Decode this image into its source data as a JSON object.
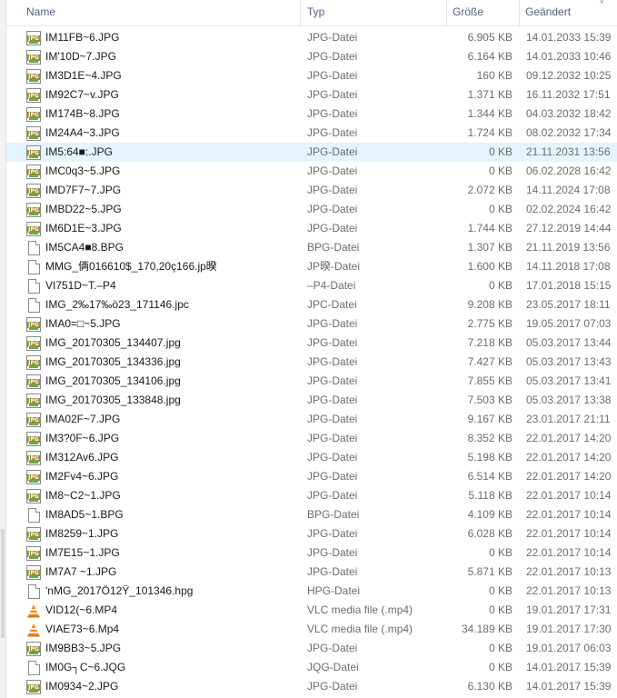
{
  "columns": {
    "name": "Name",
    "type": "Typ",
    "size": "Größe",
    "date": "Geändert"
  },
  "files": [
    {
      "name": "IM11FB~6.JPG",
      "type": "JPG-Datei",
      "size": "6.905 KB",
      "date": "14.01.2033 15:39",
      "icon": "jpg-file-icon"
    },
    {
      "name": "IM'10D~7.JPG",
      "type": "JPG-Datei",
      "size": "6.164 KB",
      "date": "14.01.2033 10:46",
      "icon": "jpg-file-icon"
    },
    {
      "name": "IM3D1E~4.JPG",
      "type": "JPG-Datei",
      "size": "160 KB",
      "date": "09.12.2032 10:25",
      "icon": "jpg-file-icon"
    },
    {
      "name": "IM92C7~v.JPG",
      "type": "JPG-Datei",
      "size": "1.371 KB",
      "date": "16.11.2032 17:51",
      "icon": "jpg-file-icon"
    },
    {
      "name": "IM174B~8.JPG",
      "type": "JPG-Datei",
      "size": "1.344 KB",
      "date": "04.03.2032 18:42",
      "icon": "jpg-file-icon"
    },
    {
      "name": "IM24A4~3.JPG",
      "type": "JPG-Datei",
      "size": "1.724 KB",
      "date": "08.02.2032 17:34",
      "icon": "jpg-file-icon"
    },
    {
      "name": "IM5:64■:.JPG",
      "type": "JPG-Datei",
      "size": "0 KB",
      "date": "21.11.2031 13:56",
      "icon": "jpg-file-icon",
      "selected": true
    },
    {
      "name": "IMC0q3~5.JPG",
      "type": "JPG-Datei",
      "size": "0 KB",
      "date": "06.02.2028 16:42",
      "icon": "jpg-file-icon"
    },
    {
      "name": "IMD7F7~7.JPG",
      "type": "JPG-Datei",
      "size": "2.072 KB",
      "date": "14.11.2024 17:08",
      "icon": "jpg-file-icon"
    },
    {
      "name": "IMBD22~5.JPG",
      "type": "JPG-Datei",
      "size": "0 KB",
      "date": "02.02.2024 16:42",
      "icon": "jpg-file-icon"
    },
    {
      "name": "IM6D1E~3.JPG",
      "type": "JPG-Datei",
      "size": "1.744 KB",
      "date": "27.12.2019 14:44",
      "icon": "jpg-file-icon"
    },
    {
      "name": "IM5CA4■8.BPG",
      "type": "BPG-Datei",
      "size": "1.307 KB",
      "date": "21.11.2019 13:56",
      "icon": "generic-file-icon"
    },
    {
      "name": "MMG_俩016610$_170,20ç166.jp暌",
      "type": "JP暌-Datei",
      "size": "1.600 KB",
      "date": "14.11.2018 17:08",
      "icon": "generic-file-icon"
    },
    {
      "name": "VI751D~T.–P4",
      "type": "–P4-Datei",
      "size": "0 KB",
      "date": "17.01.2018 15:15",
      "icon": "generic-file-icon"
    },
    {
      "name": "IMG_2‰17‰ö23_171146.jpc",
      "type": "JPC-Datei",
      "size": "9.208 KB",
      "date": "23.05.2017 18:11",
      "icon": "generic-file-icon"
    },
    {
      "name": "IMA0=□~5.JPG",
      "type": "JPG-Datei",
      "size": "2.775 KB",
      "date": "19.05.2017 07:03",
      "icon": "jpg-file-icon"
    },
    {
      "name": "IMG_20170305_134407.jpg",
      "type": "JPG-Datei",
      "size": "7.218 KB",
      "date": "05.03.2017 13:44",
      "icon": "jpg-file-icon"
    },
    {
      "name": "IMG_20170305_134336.jpg",
      "type": "JPG-Datei",
      "size": "7.427 KB",
      "date": "05.03.2017 13:43",
      "icon": "jpg-file-icon"
    },
    {
      "name": "IMG_20170305_134106.jpg",
      "type": "JPG-Datei",
      "size": "7.855 KB",
      "date": "05.03.2017 13:41",
      "icon": "jpg-file-icon"
    },
    {
      "name": "IMG_20170305_133848.jpg",
      "type": "JPG-Datei",
      "size": "7.503 KB",
      "date": "05.03.2017 13:38",
      "icon": "jpg-file-icon"
    },
    {
      "name": "IMA02F~7.JPG",
      "type": "JPG-Datei",
      "size": "9.167 KB",
      "date": "23.01.2017 21:11",
      "icon": "jpg-file-icon"
    },
    {
      "name": "IM3?0F~6.JPG",
      "type": "JPG-Datei",
      "size": "8.352 KB",
      "date": "22.01.2017 14:20",
      "icon": "jpg-file-icon"
    },
    {
      "name": "IM312Av6.JPG",
      "type": "JPG-Datei",
      "size": "5.198 KB",
      "date": "22.01.2017 14:20",
      "icon": "jpg-file-icon"
    },
    {
      "name": "IM2Fv4~6.JPG",
      "type": "JPG-Datei",
      "size": "6.514 KB",
      "date": "22.01.2017 14:20",
      "icon": "jpg-file-icon"
    },
    {
      "name": "IM8~C2~1.JPG",
      "type": "JPG-Datei",
      "size": "5.118 KB",
      "date": "22.01.2017 10:14",
      "icon": "jpg-file-icon"
    },
    {
      "name": "IM8AD5~1.BPG",
      "type": "BPG-Datei",
      "size": "4.109 KB",
      "date": "22.01.2017 10:14",
      "icon": "generic-file-icon"
    },
    {
      "name": "IM8259~1.JPG",
      "type": "JPG-Datei",
      "size": "6.028 KB",
      "date": "22.01.2017 10:14",
      "icon": "jpg-file-icon"
    },
    {
      "name": "IM7E15~1.JPG",
      "type": "JPG-Datei",
      "size": "0 KB",
      "date": "22.01.2017 10:14",
      "icon": "jpg-file-icon"
    },
    {
      "name": "IM7A7  ~1.JPG",
      "type": "JPG-Datei",
      "size": "5.871 KB",
      "date": "22.01.2017 10:13",
      "icon": "jpg-file-icon"
    },
    {
      "name": "'nMG_2017Ö12Ÿ_101346.hpg",
      "type": "HPG-Datei",
      "size": "0 KB",
      "date": "22.01.2017 10:13",
      "icon": "generic-file-icon"
    },
    {
      "name": "VID12(~6.MP4",
      "type": "VLC media file (.mp4)",
      "size": "0 KB",
      "date": "19.01.2017 17:31",
      "icon": "vlc-icon"
    },
    {
      "name": "VIAE73~6.Mp4",
      "type": "VLC media file (.mp4)",
      "size": "34.189 KB",
      "date": "19.01.2017 17:30",
      "icon": "vlc-icon"
    },
    {
      "name": "IM9BB3~5.JPG",
      "type": "JPG-Datei",
      "size": "0 KB",
      "date": "19.01.2017 06:03",
      "icon": "jpg-file-icon"
    },
    {
      "name": "IM0G┐C~6.JQG",
      "type": "JQG-Datei",
      "size": "0 KB",
      "date": "14.01.2017 15:39",
      "icon": "generic-file-icon"
    },
    {
      "name": "IM0934~2.JPG",
      "type": "JPG-Datei",
      "size": "6.130 KB",
      "date": "14.01.2017 15:39",
      "icon": "jpg-file-icon"
    }
  ]
}
